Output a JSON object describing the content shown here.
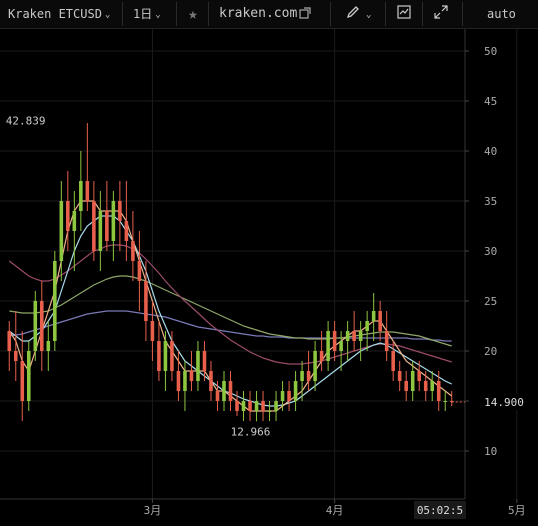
{
  "toolbar": {
    "symbol": "Kraken ETCUSD",
    "interval": "1日",
    "site": "kraken.com",
    "scale_mode": "auto",
    "icons": [
      "chevron-down-icon",
      "star-icon",
      "external-link-icon",
      "pencil-icon",
      "chart-template-icon",
      "fullscreen-icon"
    ]
  },
  "price_badge": "14.900",
  "time_badge": "05:02:5",
  "annotations": {
    "high": "42.839",
    "low": "12.966"
  },
  "colors": {
    "background": "#000000",
    "grid": "#1c1c1c",
    "up": "#8dc63f",
    "down": "#e8604c",
    "ma_short": "#f0b48a",
    "ma_mid": "#a8ddee",
    "ma_long1": "#9a4b6b",
    "ma_long2": "#8fa86a",
    "ma_long3": "#7a7ab8"
  },
  "chart_data": {
    "type": "candlestick",
    "y_ticks": [
      "50",
      "45",
      "40",
      "35",
      "30",
      "25",
      "20",
      "15",
      "10"
    ],
    "ylim": [
      5,
      52
    ],
    "x_ticks": [
      "3月",
      "4月",
      "5月"
    ],
    "x_tick_index": [
      22,
      50,
      78
    ],
    "last_price": 14.9,
    "annotations": [
      {
        "label": "42.839",
        "value": 42.839
      },
      {
        "label": "12.966",
        "value": 12.966
      }
    ],
    "candles": [
      [
        22,
        23,
        18,
        20
      ],
      [
        20,
        24,
        17,
        19
      ],
      [
        19,
        22,
        13,
        15
      ],
      [
        15,
        21,
        14,
        20
      ],
      [
        20,
        26,
        19,
        25
      ],
      [
        25,
        27,
        18,
        20
      ],
      [
        20,
        23,
        18,
        21
      ],
      [
        21,
        30,
        20,
        29
      ],
      [
        29,
        37,
        27,
        35
      ],
      [
        35,
        38,
        30,
        32
      ],
      [
        32,
        36,
        28,
        34
      ],
      [
        34,
        40,
        32,
        37
      ],
      [
        37,
        42.8,
        34,
        35
      ],
      [
        35,
        37,
        29,
        30
      ],
      [
        30,
        36,
        28,
        34
      ],
      [
        34,
        37,
        30,
        31
      ],
      [
        31,
        36,
        29,
        35
      ],
      [
        35,
        37,
        30,
        33
      ],
      [
        33,
        37,
        29,
        31
      ],
      [
        31,
        34,
        27,
        29
      ],
      [
        29,
        32,
        24,
        27
      ],
      [
        27,
        29,
        21,
        23
      ],
      [
        23,
        25,
        19,
        21
      ],
      [
        21,
        23,
        17,
        18
      ],
      [
        18,
        22,
        16,
        21
      ],
      [
        21,
        22,
        17,
        18
      ],
      [
        18,
        20,
        15,
        16
      ],
      [
        16,
        19,
        14,
        18
      ],
      [
        18,
        20,
        16,
        17
      ],
      [
        17,
        21,
        16,
        20
      ],
      [
        20,
        21,
        17,
        18
      ],
      [
        18,
        19,
        15,
        16
      ],
      [
        16,
        17,
        14,
        15
      ],
      [
        15,
        18,
        14,
        17
      ],
      [
        17,
        18,
        14,
        15
      ],
      [
        15,
        16,
        13.5,
        14
      ],
      [
        14,
        16,
        13,
        15
      ],
      [
        15,
        16,
        13,
        14
      ],
      [
        14,
        16,
        12.966,
        15
      ],
      [
        15,
        16,
        13,
        14
      ],
      [
        14,
        15,
        13,
        14
      ],
      [
        14,
        16,
        13,
        15
      ],
      [
        15,
        17,
        14,
        16
      ],
      [
        16,
        17,
        14,
        15
      ],
      [
        15,
        18,
        14,
        17
      ],
      [
        17,
        19,
        15,
        18
      ],
      [
        18,
        20,
        16,
        17
      ],
      [
        17,
        21,
        16,
        20
      ],
      [
        20,
        22,
        18,
        19
      ],
      [
        19,
        23,
        18,
        22
      ],
      [
        22,
        23,
        19,
        20
      ],
      [
        20,
        22,
        18,
        21
      ],
      [
        21,
        23,
        19,
        22
      ],
      [
        22,
        24,
        20,
        21
      ],
      [
        21,
        23,
        19,
        22
      ],
      [
        22,
        24,
        20,
        23
      ],
      [
        23,
        25.8,
        21,
        24
      ],
      [
        24,
        25,
        21,
        22
      ],
      [
        22,
        24,
        19,
        20
      ],
      [
        20,
        21,
        17,
        18
      ],
      [
        18,
        19,
        16,
        17
      ],
      [
        17,
        18,
        15,
        16
      ],
      [
        16,
        19,
        15,
        18
      ],
      [
        18,
        19,
        16,
        17
      ],
      [
        17,
        18,
        15,
        16
      ],
      [
        16,
        18,
        15,
        17
      ],
      [
        17,
        18,
        14,
        15
      ],
      [
        15,
        16,
        14,
        15
      ],
      [
        15,
        16,
        14.5,
        14.9
      ]
    ],
    "ma_short": [
      22,
      21,
      19,
      18,
      20,
      22,
      24,
      26,
      29,
      32,
      34,
      35,
      35,
      35,
      34,
      34,
      34,
      34,
      33,
      31,
      29,
      27,
      25,
      23,
      21,
      20,
      19,
      18,
      18,
      18,
      18,
      17,
      16,
      16,
      15.5,
      15,
      14.5,
      14,
      14,
      14,
      14,
      14,
      14.5,
      15,
      15.5,
      16,
      17,
      18,
      19,
      20,
      20.5,
      21,
      21.5,
      22,
      22,
      22.5,
      23,
      23,
      22,
      21,
      20,
      19,
      18.5,
      18,
      17.5,
      17,
      16.5,
      16,
      15.5
    ],
    "ma_mid": [
      22,
      21.5,
      21,
      21,
      21.5,
      22,
      23,
      24,
      26,
      28,
      30,
      31.5,
      32.5,
      33,
      33.5,
      33.5,
      33.5,
      33,
      32,
      31,
      29.5,
      28,
      26,
      24,
      22.5,
      21,
      20,
      19,
      18.5,
      18,
      17.5,
      17,
      16.5,
      16,
      15.8,
      15.5,
      15.2,
      15,
      14.8,
      14.6,
      14.5,
      14.5,
      14.6,
      14.8,
      15,
      15.5,
      16,
      16.5,
      17,
      17.5,
      18,
      18.5,
      19,
      19.5,
      20,
      20.3,
      20.6,
      20.8,
      20.6,
      20.2,
      19.8,
      19.4,
      19,
      18.6,
      18.2,
      17.8,
      17.4,
      17,
      16.7
    ],
    "ma_long1": [
      29,
      28.5,
      28,
      27.5,
      27.2,
      27,
      27,
      27.2,
      27.6,
      28,
      28.5,
      29,
      29.5,
      30,
      30.2,
      30.5,
      30.6,
      30.6,
      30.5,
      30.2,
      29.8,
      29.2,
      28.5,
      27.8,
      27,
      26.3,
      25.6,
      25,
      24.4,
      23.8,
      23.2,
      22.6,
      22.1,
      21.6,
      21.1,
      20.7,
      20.3,
      19.9,
      19.6,
      19.3,
      19.1,
      18.9,
      18.8,
      18.7,
      18.7,
      18.7,
      18.8,
      18.9,
      19,
      19.2,
      19.4,
      19.6,
      19.8,
      20,
      20.2,
      20.4,
      20.6,
      20.7,
      20.7,
      20.6,
      20.5,
      20.3,
      20.1,
      19.9,
      19.7,
      19.5,
      19.3,
      19.1,
      18.9
    ],
    "ma_long2": [
      24,
      23.9,
      23.8,
      23.8,
      23.8,
      23.9,
      24,
      24.3,
      24.6,
      25,
      25.4,
      25.8,
      26.2,
      26.6,
      26.9,
      27.2,
      27.4,
      27.5,
      27.5,
      27.4,
      27.2,
      27,
      26.7,
      26.4,
      26.1,
      25.8,
      25.5,
      25.2,
      24.9,
      24.6,
      24.3,
      24,
      23.7,
      23.4,
      23.1,
      22.8,
      22.5,
      22.3,
      22.1,
      21.9,
      21.7,
      21.6,
      21.5,
      21.4,
      21.3,
      21.3,
      21.2,
      21.2,
      21.2,
      21.2,
      21.3,
      21.3,
      21.4,
      21.5,
      21.6,
      21.7,
      21.8,
      21.9,
      21.9,
      21.9,
      21.8,
      21.7,
      21.6,
      21.5,
      21.3,
      21.1,
      20.9,
      20.7,
      20.5
    ],
    "ma_long3": [
      21.5,
      21.6,
      21.7,
      21.9,
      22.1,
      22.3,
      22.5,
      22.7,
      22.9,
      23.1,
      23.3,
      23.5,
      23.7,
      23.8,
      23.9,
      24,
      24,
      24,
      24,
      23.9,
      23.8,
      23.7,
      23.6,
      23.5,
      23.4,
      23.2,
      23,
      22.8,
      22.6,
      22.4,
      22.3,
      22.2,
      22.1,
      22,
      21.9,
      21.8,
      21.7,
      21.6,
      21.5,
      21.5,
      21.4,
      21.4,
      21.4,
      21.3,
      21.3,
      21.3,
      21.3,
      21.3,
      21.3,
      21.3,
      21.3,
      21.3,
      21.3,
      21.3,
      21.3,
      21.3,
      21.3,
      21.3,
      21.3,
      21.3,
      21.3,
      21.3,
      21.2,
      21.2,
      21.2,
      21.1,
      21.1,
      21,
      21
    ]
  }
}
